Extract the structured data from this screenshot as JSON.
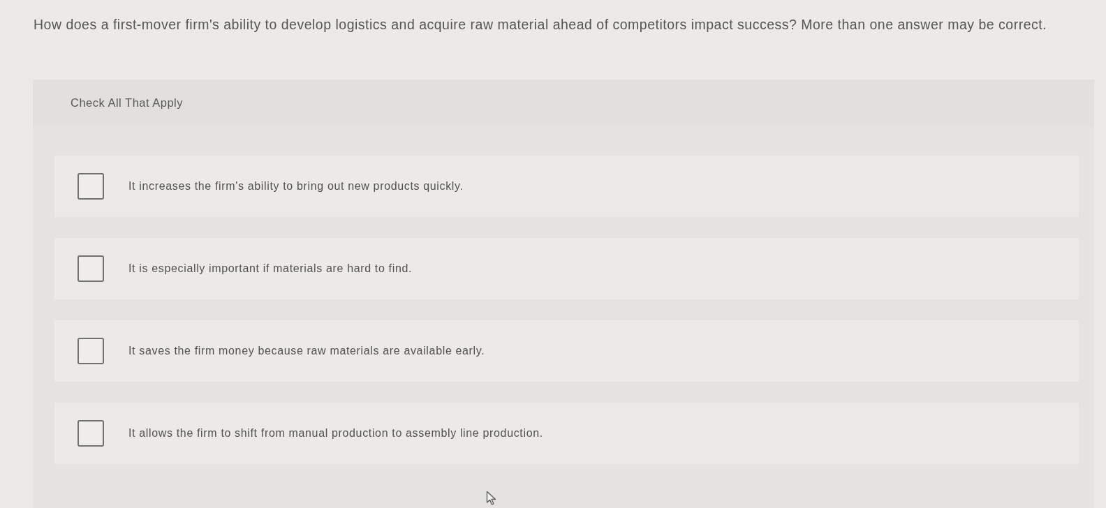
{
  "question": {
    "text": "How does a first-mover firm's ability to develop logistics and acquire raw material ahead of competitors impact success? More than one answer may be correct."
  },
  "answer_panel": {
    "instruction": "Check All That Apply",
    "options": [
      {
        "label": "It increases the firm's ability to bring out new products quickly.",
        "checked": false
      },
      {
        "label": "It is especially important if materials are hard to find.",
        "checked": false
      },
      {
        "label": "It saves the firm money because raw materials are available early.",
        "checked": false
      },
      {
        "label": "It allows the firm to shift from manual production to assembly line production.",
        "checked": false
      }
    ]
  }
}
